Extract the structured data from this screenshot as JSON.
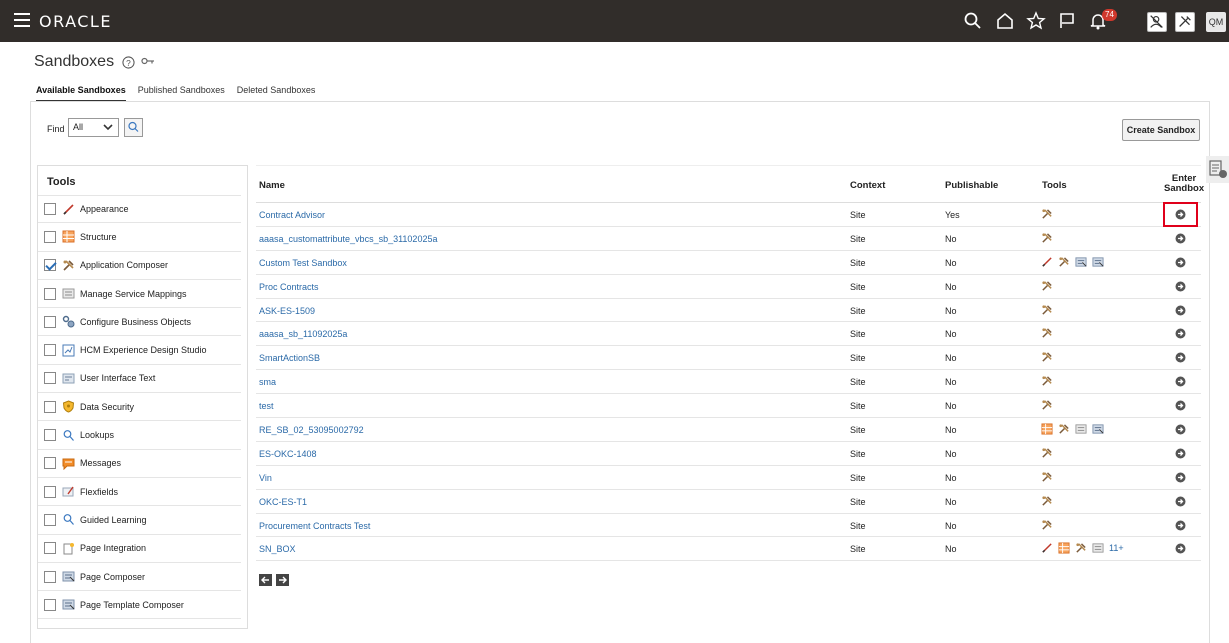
{
  "header": {
    "logo": "ORACLE",
    "notification_count": "74",
    "user_initials": "QM"
  },
  "page": {
    "title": "Sandboxes"
  },
  "tabs": [
    {
      "label": "Available Sandboxes",
      "active": true
    },
    {
      "label": "Published Sandboxes",
      "active": false
    },
    {
      "label": "Deleted Sandboxes",
      "active": false
    }
  ],
  "find": {
    "label": "Find",
    "selected": "All"
  },
  "create_button": "Create Sandbox",
  "tools_panel": {
    "heading": "Tools",
    "items": [
      {
        "label": "Appearance",
        "icon": "pencil-icon",
        "checked": false
      },
      {
        "label": "Structure",
        "icon": "structure-icon",
        "checked": false
      },
      {
        "label": "Application Composer",
        "icon": "tools-icon",
        "checked": true
      },
      {
        "label": "Manage Service Mappings",
        "icon": "mappings-icon",
        "checked": false
      },
      {
        "label": "Configure Business Objects",
        "icon": "gears-icon",
        "checked": false
      },
      {
        "label": "HCM Experience Design Studio",
        "icon": "design-studio-icon",
        "checked": false
      },
      {
        "label": "User Interface Text",
        "icon": "text-icon",
        "checked": false
      },
      {
        "label": "Data Security",
        "icon": "shield-icon",
        "checked": false
      },
      {
        "label": "Lookups",
        "icon": "search-icon",
        "checked": false
      },
      {
        "label": "Messages",
        "icon": "message-icon",
        "checked": false
      },
      {
        "label": "Flexfields",
        "icon": "flexfield-icon",
        "checked": false
      },
      {
        "label": "Guided Learning",
        "icon": "search-icon",
        "checked": false
      },
      {
        "label": "Page Integration",
        "icon": "page-integration-icon",
        "checked": false
      },
      {
        "label": "Page Composer",
        "icon": "page-composer-icon",
        "checked": false
      },
      {
        "label": "Page Template Composer",
        "icon": "page-composer-icon",
        "checked": false
      }
    ]
  },
  "grid": {
    "columns": {
      "name": "Name",
      "context": "Context",
      "publishable": "Publishable",
      "tools": "Tools",
      "enter_line1": "Enter",
      "enter_line2": "Sandbox"
    },
    "rows": [
      {
        "name": "Contract Advisor",
        "context": "Site",
        "publishable": "Yes",
        "tools": [
          "tools"
        ]
      },
      {
        "name": "aaasa_customattribute_vbcs_sb_31102025a",
        "context": "Site",
        "publishable": "No",
        "tools": [
          "tools"
        ]
      },
      {
        "name": "Custom Test Sandbox",
        "context": "Site",
        "publishable": "No",
        "tools": [
          "pencil",
          "tools",
          "page",
          "page"
        ]
      },
      {
        "name": "Proc Contracts",
        "context": "Site",
        "publishable": "No",
        "tools": [
          "tools"
        ]
      },
      {
        "name": "ASK-ES-1509",
        "context": "Site",
        "publishable": "No",
        "tools": [
          "tools"
        ]
      },
      {
        "name": "aaasa_sb_11092025a",
        "context": "Site",
        "publishable": "No",
        "tools": [
          "tools"
        ]
      },
      {
        "name": "SmartActionSB",
        "context": "Site",
        "publishable": "No",
        "tools": [
          "tools"
        ]
      },
      {
        "name": "sma",
        "context": "Site",
        "publishable": "No",
        "tools": [
          "tools"
        ]
      },
      {
        "name": "test",
        "context": "Site",
        "publishable": "No",
        "tools": [
          "tools"
        ]
      },
      {
        "name": "RE_SB_02_53095002792",
        "context": "Site",
        "publishable": "No",
        "tools": [
          "structure",
          "tools",
          "mappings",
          "page"
        ]
      },
      {
        "name": "ES-OKC-1408",
        "context": "Site",
        "publishable": "No",
        "tools": [
          "tools"
        ]
      },
      {
        "name": "Vin",
        "context": "Site",
        "publishable": "No",
        "tools": [
          "tools"
        ]
      },
      {
        "name": "OKC-ES-T1",
        "context": "Site",
        "publishable": "No",
        "tools": [
          "tools"
        ]
      },
      {
        "name": "Procurement Contracts Test",
        "context": "Site",
        "publishable": "No",
        "tools": [
          "tools"
        ]
      },
      {
        "name": "SN_BOX",
        "context": "Site",
        "publishable": "No",
        "tools": [
          "pencil",
          "structure",
          "tools",
          "mappings"
        ],
        "more": "11+"
      }
    ]
  }
}
